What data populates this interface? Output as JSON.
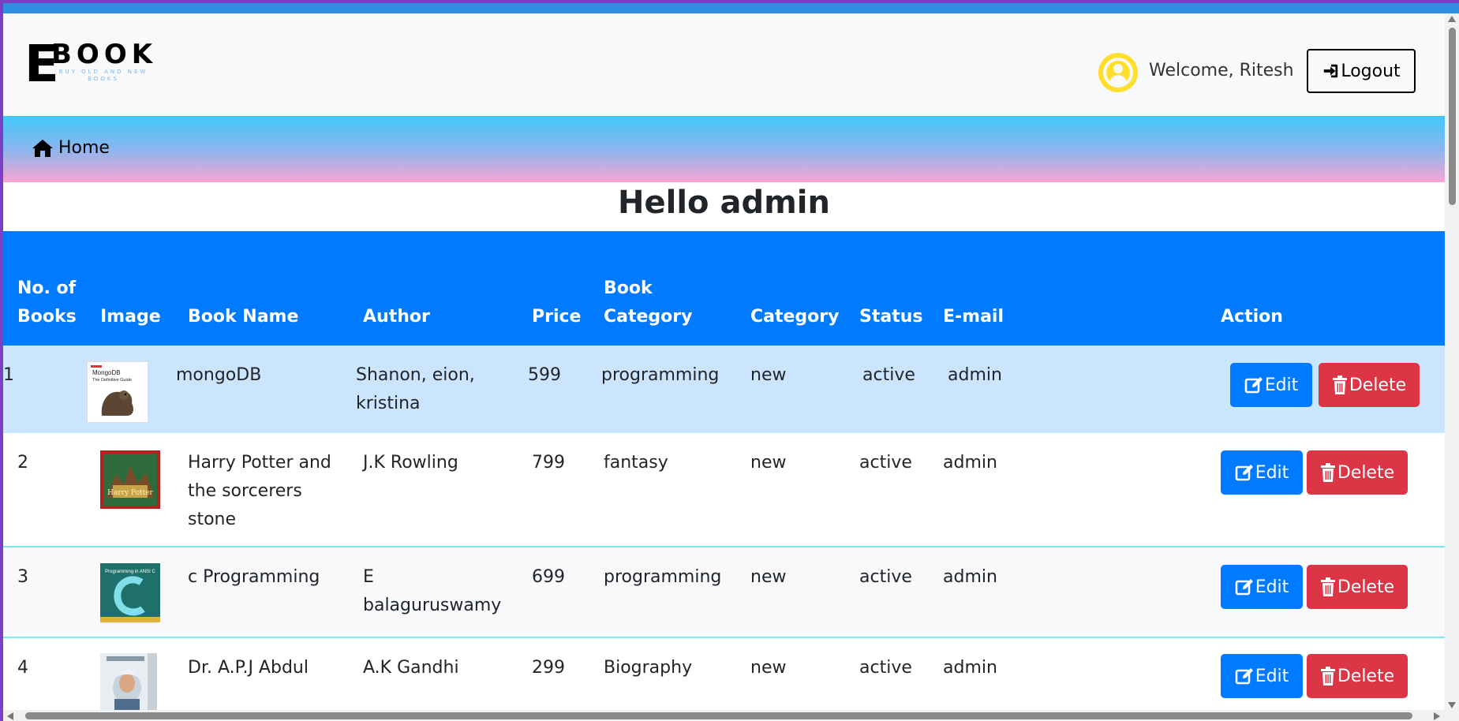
{
  "brand": {
    "letter": "E",
    "word": "BOOK",
    "tagline": "BUY OLD AND NEW BOOKS"
  },
  "header": {
    "welcome": "Welcome, Ritesh",
    "logout_label": "Logout"
  },
  "nav": {
    "home_label": "Home"
  },
  "page": {
    "title": "Hello admin"
  },
  "table": {
    "headers": {
      "no": "No. of Books",
      "image": "Image",
      "name": "Book Name",
      "author": "Author",
      "price": "Price",
      "book_category": "Book Category",
      "category": "Category",
      "status": "Status",
      "email": "E-mail",
      "action": "Action"
    },
    "edit_label": "Edit",
    "delete_label": "Delete",
    "rows": [
      {
        "no": "1",
        "name": "mongoDB",
        "author": "Shanon, eion, kristina",
        "price": "599",
        "book_category": "programming",
        "category": "new",
        "status": "active",
        "email": "admin",
        "cover_title": "MongoDB",
        "cover_sub": "The Definitive Guide"
      },
      {
        "no": "2",
        "name": "Harry Potter and the sorcerers stone",
        "author": "J.K Rowling",
        "price": "799",
        "book_category": "fantasy",
        "category": "new",
        "status": "active",
        "email": "admin",
        "cover_title": "Harry Potter"
      },
      {
        "no": "3",
        "name": "c Programming",
        "author": "E balaguruswamy",
        "price": "699",
        "book_category": "programming",
        "category": "new",
        "status": "active",
        "email": "admin",
        "cover_title": "Programming in ANSI C"
      },
      {
        "no": "4",
        "name": "Dr. A.P.J Abdul",
        "author": "A.K Gandhi",
        "price": "299",
        "book_category": "Biography",
        "category": "new",
        "status": "active",
        "email": "admin"
      }
    ]
  },
  "colors": {
    "primary": "#007bff",
    "danger": "#dc3545",
    "row_highlight": "#cce5ff",
    "row_border": "#7ee7f0",
    "user_icon": "#ffdf2b"
  }
}
